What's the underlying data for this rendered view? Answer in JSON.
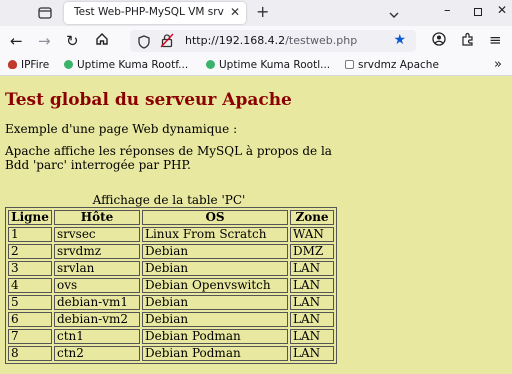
{
  "browser": {
    "tab_title": "Test Web-PHP-MySQL VM srv",
    "url_host": "http://192.168.4.2",
    "url_path": "/testweb.php",
    "bookmarks": [
      {
        "label": "IPFire",
        "color": "#c0392b"
      },
      {
        "label": "Uptime Kuma Rootf...",
        "color": "#3bb46b"
      },
      {
        "label": "Uptime Kuma Rootl...",
        "color": "#3bb46b"
      },
      {
        "label": "srvdmz Apache",
        "color": "#7a7a88"
      }
    ]
  },
  "page": {
    "title": "Test global du serveur Apache",
    "intro": "Exemple d'une page Web dynamique :",
    "description": "Apache affiche les réponses de MySQL à propos de la Bdd 'parc' interrogée par PHP.",
    "table_caption": "Affichage de la table 'PC'",
    "table": {
      "headers": [
        "Ligne",
        "Hôte",
        "OS",
        "Zone"
      ],
      "rows": [
        [
          "1",
          "srvsec",
          "Linux From Scratch",
          "WAN"
        ],
        [
          "2",
          "srvdmz",
          "Debian",
          "DMZ"
        ],
        [
          "3",
          "srvlan",
          "Debian",
          "LAN"
        ],
        [
          "4",
          "ovs",
          "Debian Openvswitch",
          "LAN"
        ],
        [
          "5",
          "debian-vm1",
          "Debian",
          "LAN"
        ],
        [
          "6",
          "debian-vm2",
          "Debian",
          "LAN"
        ],
        [
          "7",
          "ctn1",
          "Debian Podman",
          "LAN"
        ],
        [
          "8",
          "ctn2",
          "Debian Podman",
          "LAN"
        ]
      ]
    }
  },
  "colors": {
    "page_background": "#e8e8a0",
    "title_color": "#8b0000",
    "accent_star": "#0a5ad6"
  }
}
